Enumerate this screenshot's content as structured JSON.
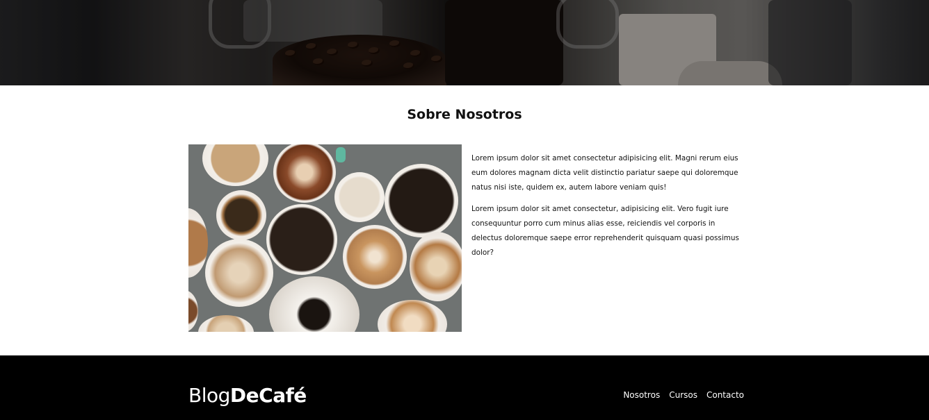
{
  "section": {
    "title": "Sobre Nosotros",
    "paragraphs": [
      "Lorem ipsum dolor sit amet consectetur adipisicing elit. Magni rerum eius eum dolores magnam dicta velit distinctio pariatur saepe qui doloremque natus nisi iste, quidem ex, autem labore veniam quis!",
      "Lorem ipsum dolor sit amet consectetur, adipisicing elit. Vero fugit iure consequuntur porro cum minus alias esse, reiciendis vel corporis in delectus doloremque saepe error reprehenderit quisquam quasi possimus dolor?"
    ]
  },
  "footer": {
    "logo_light": "Blog",
    "logo_bold": "DeCafé",
    "nav": [
      "Nosotros",
      "Cursos",
      "Contacto"
    ]
  },
  "colors": {
    "footer_bg": "#000000",
    "page_bg": "#ffffff"
  }
}
